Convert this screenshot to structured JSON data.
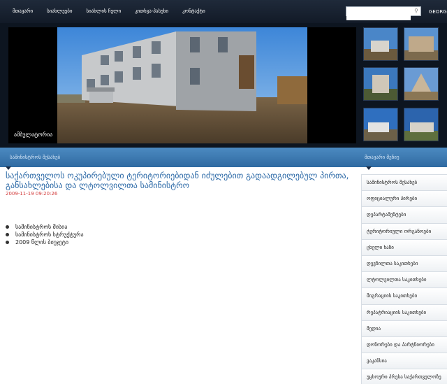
{
  "nav": {
    "items": [
      "მთავარი",
      "სიახლეები",
      "სიახლის ჩელი",
      "კითხვა-პასუხი",
      "კონტაქტი"
    ],
    "search_placeholder": "",
    "search_icon": "magnifier-icon",
    "language": "GEORGIAN"
  },
  "hero": {
    "caption": "ამბულატორია",
    "thumb_count": 6
  },
  "bar": {
    "left_label": "სამინისტროს შესახებ",
    "right_label": "მთავარი მენიუ"
  },
  "content": {
    "title": "საქართველოს ოკუპირებული ტერიტორიებიდან იძულებით გადაადგილებულ პირთა, განსახლებისა და ლტოლვილთა სამინისტრო",
    "date": "2009-11-19 09:20:26",
    "bullets": [
      "სამინისტროს მისია",
      "სამინისტროს სტრუქტურა",
      "2009 წლის ბიუჯეტი"
    ]
  },
  "sidebar": {
    "items": [
      "სამინისტროს შესახებ",
      "ოფიციალური პირები",
      "დეპარტამენტები",
      "ტერიტორიული ორგანოები",
      "ცხელი ხაზი",
      "დევნილთა საკითხები",
      "ლტოლვილთა საკითხები",
      "მიგრაციის საკითხები",
      "რეპატრიაციის საკითხები",
      "მედია",
      "დონორები და პარტნიორები",
      "ვაკანსია",
      "უცხოური პრესა საქართველოზე"
    ]
  },
  "colors": {
    "top_bar": "#1a2433",
    "blue_bar": "#3d7bb3",
    "title": "#2a68a6",
    "date": "#d23a3a"
  }
}
